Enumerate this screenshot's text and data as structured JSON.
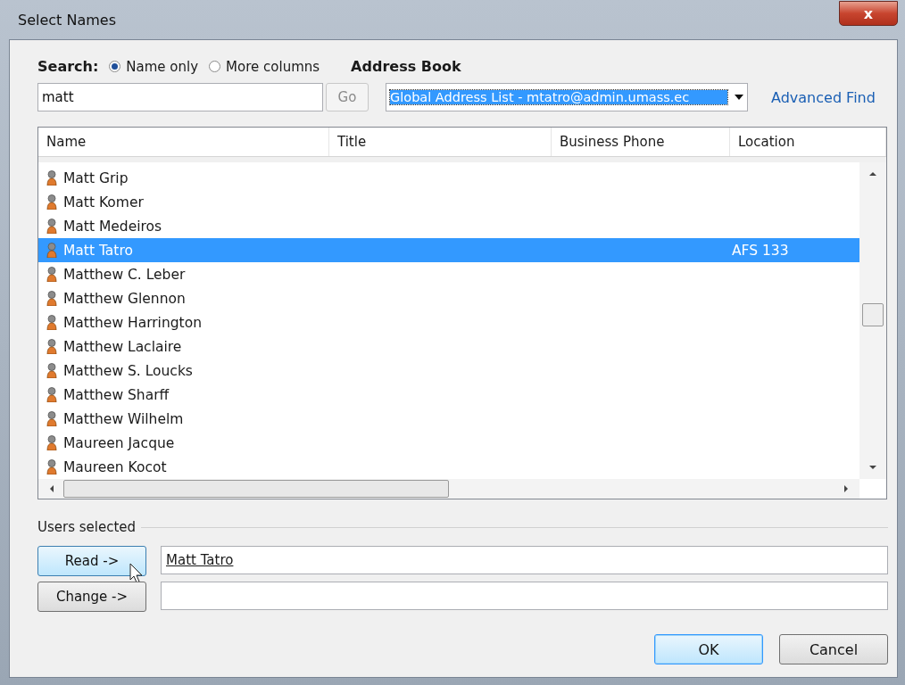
{
  "window": {
    "title": "Select Names",
    "close_label": "x"
  },
  "search": {
    "label": "Search:",
    "options": [
      {
        "label": "Name only",
        "selected": true
      },
      {
        "label": "More columns",
        "selected": false
      }
    ],
    "value": "matt",
    "go_button": "Go"
  },
  "address_book": {
    "label": "Address Book",
    "value": "Global Address List - mtatro@admin.umass.ec",
    "advanced_find": "Advanced Find"
  },
  "table": {
    "columns": [
      "Name",
      "Title",
      "Business Phone",
      "Location"
    ],
    "rows": [
      {
        "name": "Matt Grip",
        "selected": false
      },
      {
        "name": "Matt Komer",
        "selected": false
      },
      {
        "name": "Matt Medeiros",
        "selected": false
      },
      {
        "name": "Matt Tatro",
        "location": "AFS 133",
        "selected": true
      },
      {
        "name": "Matthew C. Leber",
        "selected": false
      },
      {
        "name": "Matthew Glennon",
        "selected": false
      },
      {
        "name": "Matthew Harrington",
        "selected": false
      },
      {
        "name": "Matthew Laclaire",
        "selected": false
      },
      {
        "name": "Matthew S. Loucks",
        "selected": false
      },
      {
        "name": "Matthew Sharff",
        "selected": false
      },
      {
        "name": "Matthew Wilhelm",
        "selected": false
      },
      {
        "name": "Maureen Jacque",
        "selected": false
      },
      {
        "name": "Maureen Kocot",
        "selected": false
      }
    ]
  },
  "users_selected": {
    "label": "Users selected",
    "rows": [
      {
        "button": "Read ->",
        "value": "Matt Tatro",
        "hovered": true
      },
      {
        "button": "Change ->",
        "value": "",
        "hovered": false
      }
    ]
  },
  "buttons": [
    {
      "label": "OK",
      "default": true
    },
    {
      "label": "Cancel",
      "default": false
    }
  ]
}
